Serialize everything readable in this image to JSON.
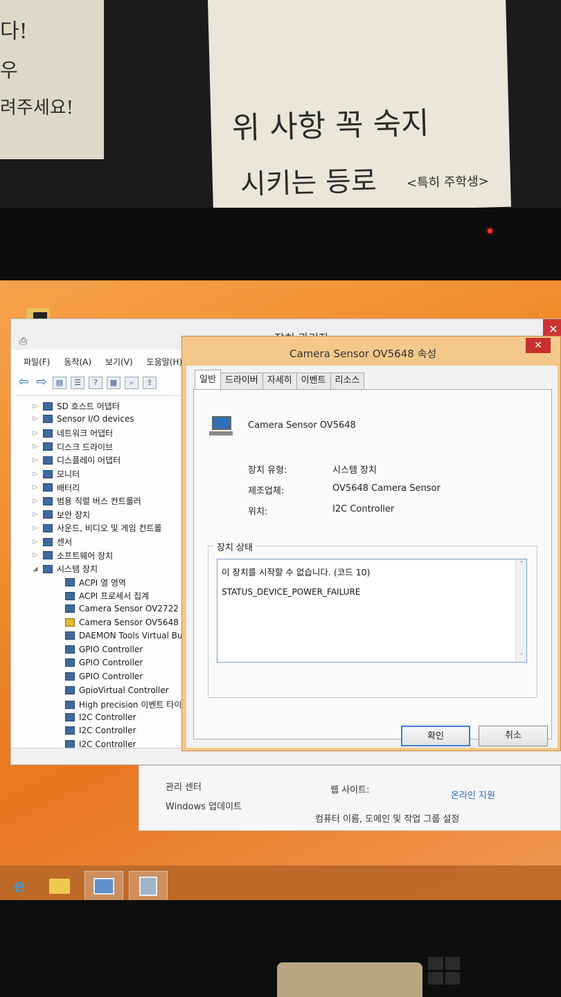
{
  "device_manager": {
    "title": "장치 관리자",
    "close": "✕",
    "menu": [
      "파일(F)",
      "동작(A)",
      "보기(V)",
      "도움말(H)"
    ],
    "tree": [
      {
        "label": "SD 호스트 어댑터",
        "level": 1,
        "expander": "▷"
      },
      {
        "label": "Sensor I/O devices",
        "level": 1,
        "expander": "▷"
      },
      {
        "label": "네트워크 어댑터",
        "level": 1,
        "expander": "▷"
      },
      {
        "label": "디스크 드라이브",
        "level": 1,
        "expander": "▷"
      },
      {
        "label": "디스플레이 어댑터",
        "level": 1,
        "expander": "▷"
      },
      {
        "label": "모니터",
        "level": 1,
        "expander": "▷"
      },
      {
        "label": "배터리",
        "level": 1,
        "expander": "▷"
      },
      {
        "label": "범용 직렬 버스 컨트롤러",
        "level": 1,
        "expander": "▷"
      },
      {
        "label": "보안 장치",
        "level": 1,
        "expander": "▷"
      },
      {
        "label": "사운드, 비디오 및 게임 컨트롤",
        "level": 1,
        "expander": "▷"
      },
      {
        "label": "센서",
        "level": 1,
        "expander": "▷"
      },
      {
        "label": "소프트웨어 장치",
        "level": 1,
        "expander": "▷"
      },
      {
        "label": "시스템 장치",
        "level": 1,
        "expander": "◢"
      },
      {
        "label": "ACPI 열 영역",
        "level": 2,
        "expander": ""
      },
      {
        "label": "ACPI 프로세서 집계",
        "level": 2,
        "expander": ""
      },
      {
        "label": "Camera Sensor OV2722",
        "level": 2,
        "expander": ""
      },
      {
        "label": "Camera Sensor OV5648",
        "level": 2,
        "expander": "",
        "warning": true
      },
      {
        "label": "DAEMON Tools Virtual Bus",
        "level": 2,
        "expander": ""
      },
      {
        "label": "GPIO Controller",
        "level": 2,
        "expander": ""
      },
      {
        "label": "GPIO Controller",
        "level": 2,
        "expander": ""
      },
      {
        "label": "GPIO Controller",
        "level": 2,
        "expander": ""
      },
      {
        "label": "GpioVirtual Controller",
        "level": 2,
        "expander": ""
      },
      {
        "label": "High precision 이벤트 타이",
        "level": 2,
        "expander": ""
      },
      {
        "label": "I2C Controller",
        "level": 2,
        "expander": ""
      },
      {
        "label": "I2C Controller",
        "level": 2,
        "expander": ""
      },
      {
        "label": "I2C Controller",
        "level": 2,
        "expander": ""
      }
    ]
  },
  "properties": {
    "title": "Camera Sensor OV5648 속성",
    "close": "✕",
    "tabs": [
      "일반",
      "드라이버",
      "자세히",
      "이벤트",
      "리소스"
    ],
    "device_name": "Camera Sensor OV5648",
    "rows": [
      {
        "label": "장치 유형:",
        "value": "시스템 장치"
      },
      {
        "label": "제조업체:",
        "value": "OV5648 Camera Sensor"
      },
      {
        "label": "위치:",
        "value": "I2C Controller"
      }
    ],
    "status_group": "장치 상태",
    "status_line1": "이 장치를 시작할 수 없습니다. (코드 10)",
    "status_line2": "STATUS_DEVICE_POWER_FAILURE",
    "ok": "확인",
    "cancel": "취소"
  },
  "system_panel": {
    "admin_center": "관리 센터",
    "windows_update": "Windows 업데이트",
    "website_label": "웹 사이트:",
    "online_support": "온라인 지원",
    "computer_settings": "컴퓨터 이름, 도메인 및 작업 그룹 설정"
  },
  "paper_notes": {
    "left1": "다!",
    "left2": "우",
    "left3": "려주세요!",
    "main1": "위 사항 꼭 숙지",
    "main2": "시키는 등로",
    "main3": "<특히 주학생>"
  },
  "colors": {
    "accent": "#f0902e",
    "close_red": "#c9302c",
    "link": "#2a67b6"
  }
}
